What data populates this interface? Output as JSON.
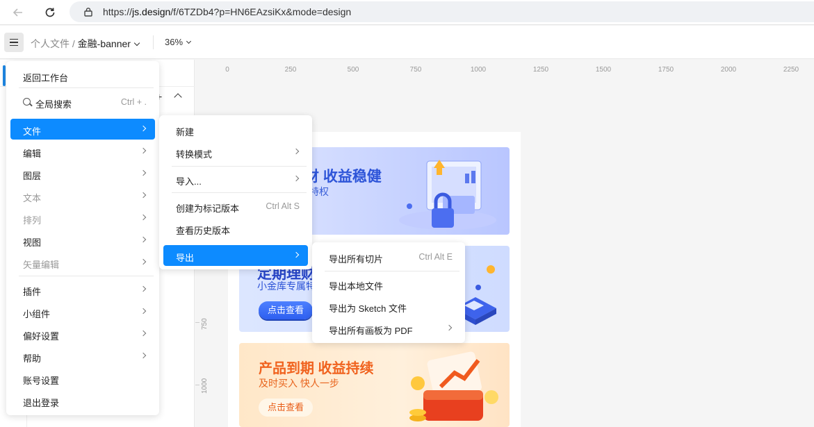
{
  "browser": {
    "back_icon": "arrow-left-icon",
    "reload_icon": "reload-icon",
    "url_prefix": "https://",
    "url_host": "js.design",
    "url_path": "/f/6TZDb4?p=HN6EAzsiKx&mode=design"
  },
  "toolbar": {
    "breadcrumb_root": "个人文件",
    "breadcrumb_sep": "/",
    "file_name": "金融-banner",
    "zoom": "36%"
  },
  "ruler": {
    "x_ticks": [
      "0",
      "250",
      "500",
      "750",
      "1000",
      "1250",
      "1500",
      "1750",
      "2000",
      "2250"
    ],
    "y_ticks": [
      "750",
      "1000"
    ]
  },
  "main_menu": {
    "back": "返回工作台",
    "search": {
      "label": "全局搜索",
      "shortcut": "Ctrl + ."
    },
    "items": [
      {
        "label": "文件"
      },
      {
        "label": "编辑"
      },
      {
        "label": "图层"
      },
      {
        "label": "文本"
      },
      {
        "label": "排列"
      },
      {
        "label": "视图"
      },
      {
        "label": "矢量编辑"
      },
      {
        "label": "插件"
      },
      {
        "label": "小组件"
      },
      {
        "label": "偏好设置"
      },
      {
        "label": "帮助"
      },
      {
        "label": "账号设置"
      },
      {
        "label": "退出登录"
      }
    ]
  },
  "file_menu": {
    "new": "新建",
    "convert": "转换模式",
    "import": "导入...",
    "create_version": {
      "label": "创建为标记版本",
      "shortcut": "Ctrl Alt S"
    },
    "history": "查看历史版本",
    "export": "导出"
  },
  "export_menu": {
    "all_slices": {
      "label": "导出所有切片",
      "shortcut": "Ctrl Alt E"
    },
    "local_file": "导出本地文件",
    "sketch": "导出为 Sketch 文件",
    "pdf": "导出所有画板为 PDF"
  },
  "banners": {
    "b1_title": "财 收益稳健",
    "b1_sub": "特权",
    "b2_title": "定期理财",
    "b2_sub": "小金库专属特",
    "b2_button": "点击查看",
    "b3_title": "产品到期 收益持续",
    "b3_sub": "及时买入  快人一步",
    "b3_button": "点击查看"
  },
  "colors": {
    "accent": "#0d8bff",
    "menu_bg": "#ffffff"
  }
}
